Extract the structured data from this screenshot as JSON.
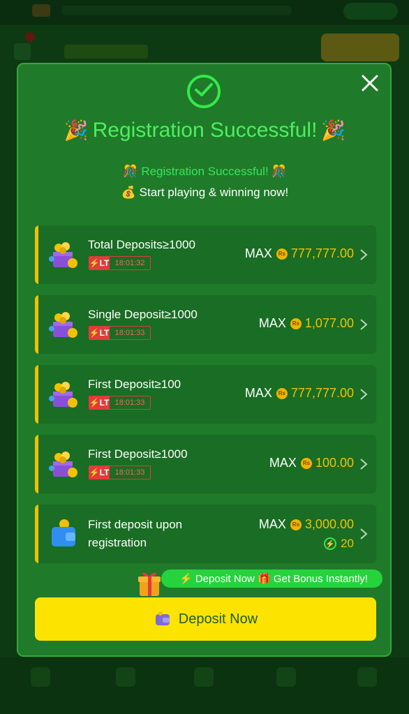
{
  "modal": {
    "title": "Registration Successful!",
    "subtitle": "Registration Successful!",
    "tagline": "Start playing & winning now!",
    "decor_emoji_title": "🎉",
    "decor_emoji_sub": "🎊",
    "decor_emoji_tagline": "💰",
    "icons": {
      "success": "check-circle-icon",
      "close": "close-icon",
      "bonus": "gift-box-icon",
      "wallet": "wallet-icon",
      "chevron": "chevron-right-icon"
    },
    "colors": {
      "modal_bg": "#1f7a2a",
      "accent_green": "#4cf05c",
      "gold": "#f2c200",
      "button_yellow": "#fde400",
      "timer_red": "#e23b3b"
    },
    "bonuses": [
      {
        "name": "Total Deposits≥1000",
        "badge": "LT",
        "timer": "18:01:32",
        "max_label": "MAX",
        "currency": "Rs",
        "amount": "777,777.00"
      },
      {
        "name": "Single Deposit≥1000",
        "badge": "LT",
        "timer": "18:01:33",
        "max_label": "MAX",
        "currency": "Rs",
        "amount": "1,077.00"
      },
      {
        "name": "First Deposit≥100",
        "badge": "LT",
        "timer": "18:01:33",
        "max_label": "MAX",
        "currency": "Rs",
        "amount": "777,777.00"
      },
      {
        "name": "First Deposit≥1000",
        "badge": "LT",
        "timer": "18:01:33",
        "max_label": "MAX",
        "currency": "Rs",
        "amount": "100.00"
      },
      {
        "name": "First deposit upon registration",
        "max_label": "MAX",
        "currency": "Rs",
        "amount": "3,000.00",
        "extra_points": "20"
      }
    ],
    "promo_banner": "⚡ Deposit Now 🎁 Get Bonus Instantly!",
    "deposit_button": "Deposit Now"
  }
}
